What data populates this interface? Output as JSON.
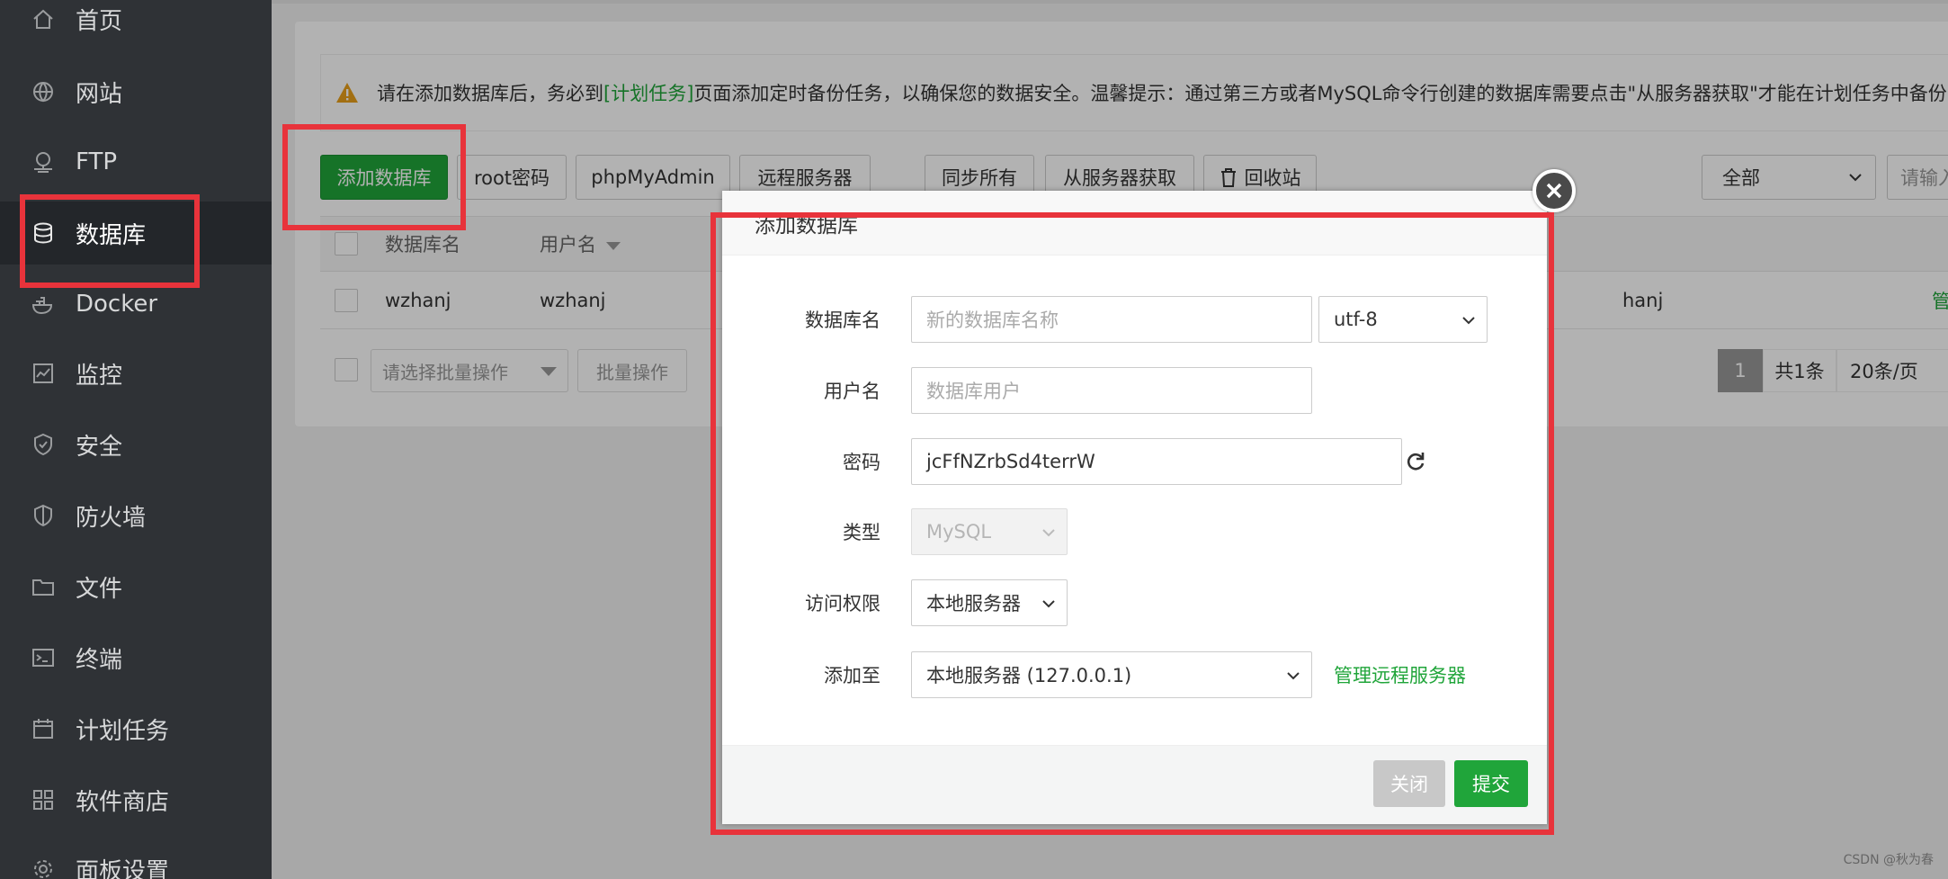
{
  "sidebar": {
    "items": [
      {
        "label": "首页",
        "icon": "home-icon"
      },
      {
        "label": "网站",
        "icon": "globe-icon"
      },
      {
        "label": "FTP",
        "icon": "ftp-icon"
      },
      {
        "label": "数据库",
        "icon": "database-icon",
        "active": true
      },
      {
        "label": "Docker",
        "icon": "docker-icon"
      },
      {
        "label": "监控",
        "icon": "monitor-icon"
      },
      {
        "label": "安全",
        "icon": "shield-icon"
      },
      {
        "label": "防火墙",
        "icon": "firewall-icon"
      },
      {
        "label": "文件",
        "icon": "folder-icon"
      },
      {
        "label": "终端",
        "icon": "terminal-icon"
      },
      {
        "label": "计划任务",
        "icon": "calendar-icon"
      },
      {
        "label": "软件商店",
        "icon": "apps-icon"
      },
      {
        "label": "面板设置",
        "icon": "gear-icon"
      }
    ]
  },
  "notice": {
    "before": "请在添加数据库后，务必到",
    "link": "[计划任务]",
    "after": "页面添加定时备份任务，以确保您的数据安全。温馨提示：通过第三方或者MySQL命令行创建的数据库需要点击\"从服务器获取\"才能在计划任务中备份"
  },
  "toolbar": {
    "add_db": "添加数据库",
    "root_pwd": "root密码",
    "phpmyadmin": "phpMyAdmin",
    "remote_server": "远程服务器",
    "sync_all": "同步所有",
    "fetch_from_server": "从服务器获取",
    "recycle_bin": "回收站",
    "filter_select": "全部",
    "search_placeholder": "请输入"
  },
  "table": {
    "headers": {
      "name": "数据库名",
      "user": "用户名"
    },
    "rows": [
      {
        "name": "wzhanj",
        "user": "wzhanj",
        "partial_user": "hanj",
        "action_partial": "管"
      }
    ]
  },
  "batch": {
    "select_placeholder": "请选择批量操作",
    "button": "批量操作"
  },
  "pager": {
    "current": "1",
    "total": "共1条",
    "size": "20条/页"
  },
  "modal": {
    "title": "添加数据库",
    "fields": {
      "db_name_label": "数据库名",
      "db_name_placeholder": "新的数据库名称",
      "charset": "utf-8",
      "user_label": "用户名",
      "user_placeholder": "数据库用户",
      "password_label": "密码",
      "password_value": "jcFfNZrbSd4terrW",
      "type_label": "类型",
      "type_value": "MySQL",
      "access_label": "访问权限",
      "access_value": "本地服务器",
      "add_to_label": "添加至",
      "add_to_value": "本地服务器 (127.0.0.1)",
      "manage_remote": "管理远程服务器"
    },
    "buttons": {
      "close": "关闭",
      "submit": "提交"
    }
  },
  "watermark": "CSDN @秋为春",
  "colors": {
    "accent": "#20a53a",
    "sidebar_bg": "#2f3236",
    "annotation": "#e8333b"
  }
}
